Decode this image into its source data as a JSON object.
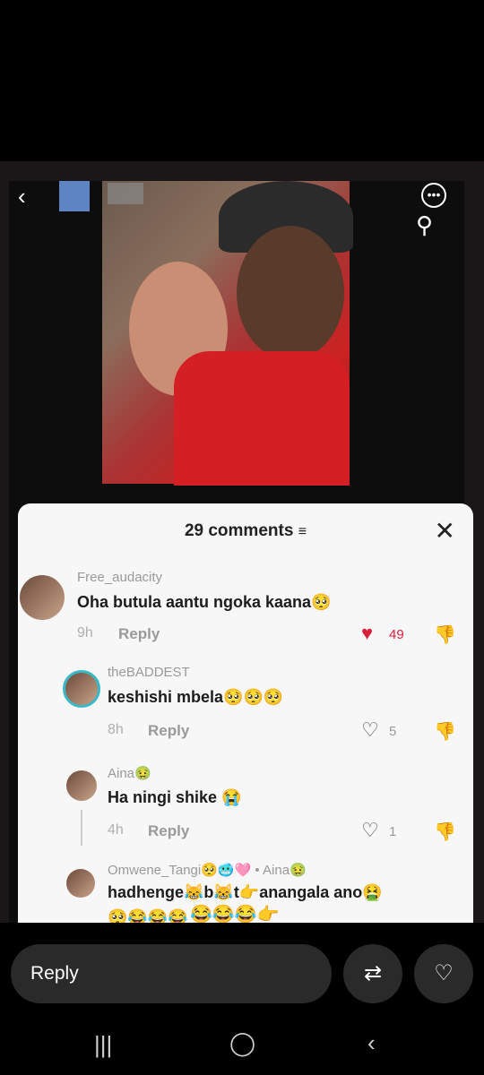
{
  "story": {
    "comments_title": "29 comments",
    "comments": [
      {
        "username": "Free_audacity",
        "text": "Oha butula aantu ngoka kaana🥺",
        "time": "9h",
        "reply": "Reply",
        "likes": "49",
        "liked": true
      },
      {
        "username": "theBADDEST",
        "text": "keshishi mbela🥺🥺🥺",
        "time": "8h",
        "reply": "Reply",
        "likes": "5",
        "liked": false
      },
      {
        "username": "Aina🤢",
        "text": "Ha ningi shike 😭",
        "time": "4h",
        "reply": "Reply",
        "likes": "1",
        "liked": false
      },
      {
        "username": "Omwene_Tangi🥺🥶🩷 • Aina🤢",
        "text": "hadhenge😹b😹t👉anangala ano🤮",
        "text2": "🥺😂😂😂"
      }
    ],
    "overlay_emojis": "😂😂😂👉"
  },
  "bottom": {
    "reply_placeholder": "Reply"
  }
}
